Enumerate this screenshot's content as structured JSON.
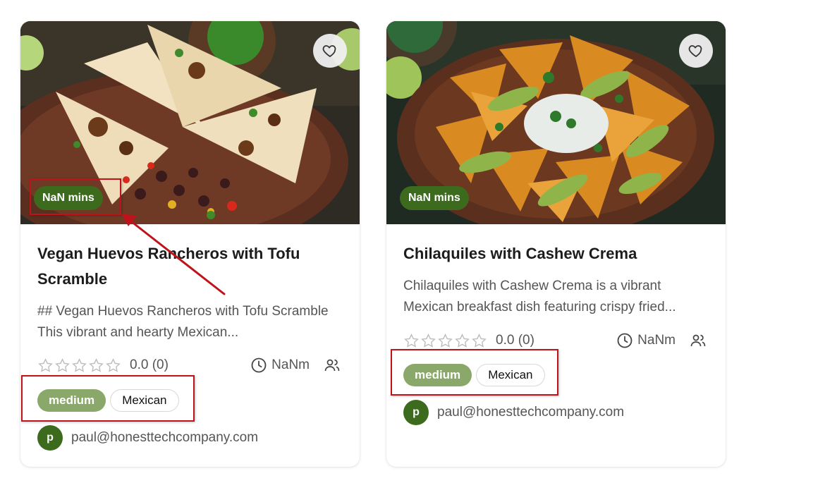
{
  "recipes": [
    {
      "title": "Vegan Huevos Rancheros with Tofu Scramble",
      "description": "## Vegan Huevos Rancheros with Tofu Scramble This vibrant and hearty Mexican...",
      "time_badge": "NaN mins",
      "rating_text": "0.0 (0)",
      "rating": 0,
      "time_text": "NaNm",
      "level_tag": "medium",
      "cuisine_tag": "Mexican",
      "author_initial": "p",
      "author_email": "paul@honesttechcompany.com"
    },
    {
      "title": "Chilaquiles with Cashew Crema",
      "description": "Chilaquiles with Cashew Crema is a vibrant Mexican breakfast dish featuring crispy fried...",
      "time_badge": "NaN mins",
      "rating_text": "0.0 (0)",
      "rating": 0,
      "time_text": "NaNm",
      "level_tag": "medium",
      "cuisine_tag": "Mexican",
      "author_initial": "p",
      "author_email": "paul@honesttechcompany.com"
    }
  ],
  "colors": {
    "brand_green": "#3d6b1e",
    "level_tag_green": "#8aa86a",
    "annotation_red": "#c0121b"
  },
  "icons": [
    "heart-icon",
    "star-outline-icon",
    "clock-icon",
    "people-icon"
  ]
}
